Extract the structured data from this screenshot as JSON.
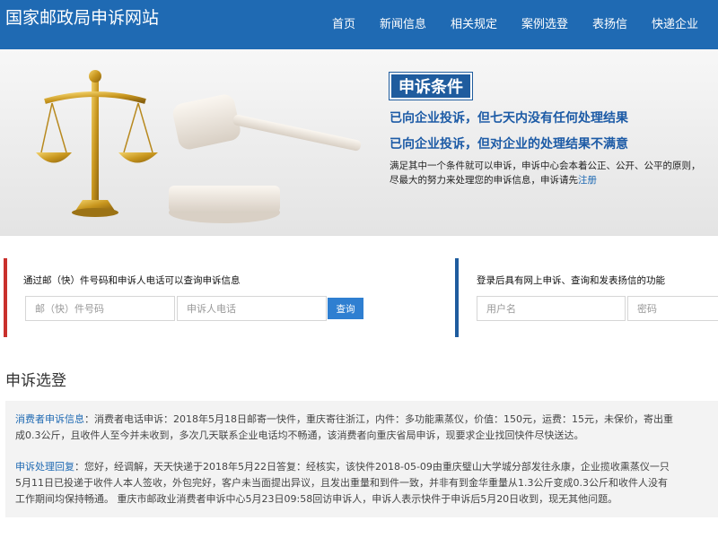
{
  "header": {
    "site_title": "国家邮政局申诉网站",
    "nav": [
      {
        "label": "首页"
      },
      {
        "label": "新闻信息"
      },
      {
        "label": "相关规定"
      },
      {
        "label": "案例选登"
      },
      {
        "label": "表扬信"
      },
      {
        "label": "快递企业"
      }
    ]
  },
  "banner": {
    "conditions_title": "申诉条件",
    "condition_1": "已向企业投诉，但七天内没有任何处理结果",
    "condition_2": "已向企业投诉，但对企业的处理结果不满意",
    "description": "满足其中一个条件就可以申诉，申诉中心会本着公正、公开、公平的原则，尽最大的努力来处理您的申诉信息，申诉请先",
    "register_link": "注册"
  },
  "query_panel": {
    "label": "通过邮（快）件号码和申诉人电话可以查询申诉信息",
    "tracking_placeholder": "邮（快）件号码",
    "phone_placeholder": "申诉人电话",
    "query_button": "查询"
  },
  "login_panel": {
    "label": "登录后具有网上申诉、查询和发表扬信的功能",
    "username_placeholder": "用户名",
    "password_placeholder": "密码"
  },
  "cases": {
    "section_title": "申诉选登",
    "consumer_tag": "消费者申诉信息",
    "consumer_lines": [
      "：消费者电话申诉：2018年5月18日邮寄一快件，重庆寄往浙江，内件：多功能熏蒸仪，价值：150元，运费：15元，未保价，寄出重",
      "成0.3公斤，且收件人至今并未收到，多次几天联系企业电话均不畅通，该消费者向重庆省局申诉，现要求企业找回快件尽快送达。"
    ],
    "reply_tag": "申诉处理回复",
    "reply_lines": [
      "：您好，经调解，天天快递于2018年5月22日答复：经核实，该快件2018-05-09由重庆璧山大学城分部发往永康，企业揽收熏蒸仪一只",
      "5月11日已投递于收件人本人签收，外包完好，客户未当面提出异议，且发出重量和到件一致，并非有到金华重量从1.3公斤变成0.3公斤和收件人没有",
      "工作期间均保持畅通。 重庆市邮政业消费者申诉中心5月23日09:58回访申诉人，申诉人表示快件于申诉后5月20日收到，现无其他问题。"
    ]
  }
}
